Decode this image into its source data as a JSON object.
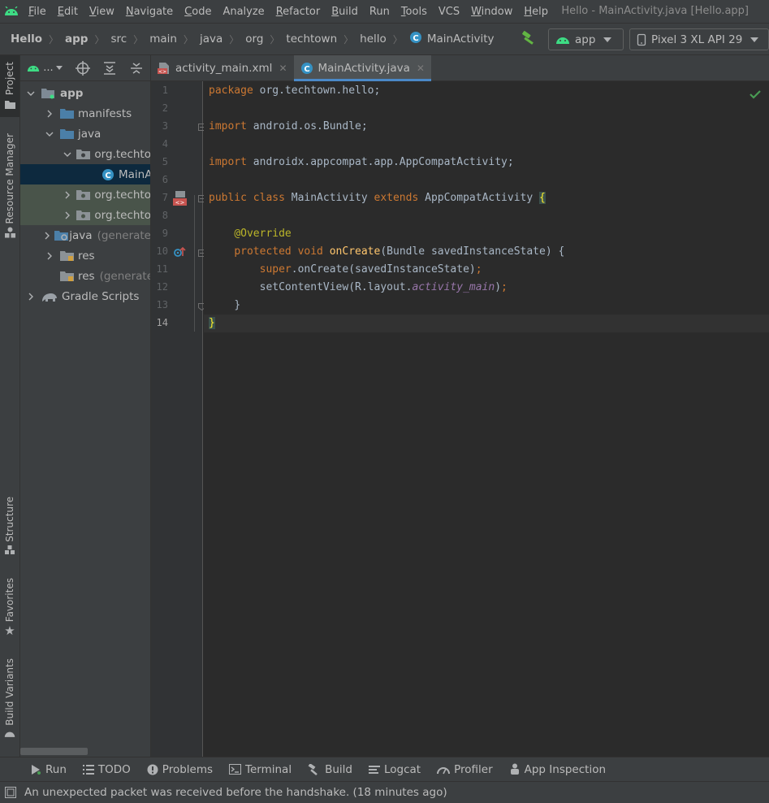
{
  "window": {
    "title": "Hello - MainActivity.java [Hello.app]"
  },
  "colors": {
    "accent": "#4a88c7",
    "android_green": "#3ddc84",
    "keyword": "#cc7832",
    "annotation": "#bbb529",
    "method": "#ffc66d",
    "field": "#9876aa",
    "text": "#a9b7c6"
  },
  "menu": [
    {
      "mnemonic": "F",
      "rest": "ile"
    },
    {
      "mnemonic": "E",
      "rest": "dit"
    },
    {
      "mnemonic": "V",
      "rest": "iew"
    },
    {
      "mnemonic": "N",
      "rest": "avigate"
    },
    {
      "mnemonic": "C",
      "rest": "ode"
    },
    {
      "mnemonic": "",
      "rest": "Analyze"
    },
    {
      "mnemonic": "R",
      "rest": "efactor"
    },
    {
      "mnemonic": "B",
      "rest": "uild"
    },
    {
      "mnemonic": "",
      "rest": "Run"
    },
    {
      "mnemonic": "T",
      "rest": "ools"
    },
    {
      "mnemonic": "",
      "rest": "VCS"
    },
    {
      "mnemonic": "W",
      "rest": "indow"
    },
    {
      "mnemonic": "H",
      "rest": "elp"
    }
  ],
  "breadcrumb": [
    "Hello",
    "app",
    "src",
    "main",
    "java",
    "org",
    "techtown",
    "hello",
    "MainActivity"
  ],
  "run_config": {
    "label": "app"
  },
  "device": {
    "label": "Pixel 3 XL API 29"
  },
  "left_stripe": {
    "project": "Project",
    "resource_manager": "Resource Manager",
    "structure": "Structure",
    "favorites": "Favorites",
    "build_variants": "Build Variants"
  },
  "project_panel": {
    "view_label": "...",
    "tree": [
      {
        "label": "app",
        "extra": ""
      },
      {
        "label": "manifests",
        "extra": ""
      },
      {
        "label": "java",
        "extra": ""
      },
      {
        "label": "org.techto",
        "extra": ""
      },
      {
        "label": "MainA",
        "extra": ""
      },
      {
        "label": "org.techto",
        "extra": ""
      },
      {
        "label": "org.techto",
        "extra": ""
      },
      {
        "label": "java",
        "extra": "(generate"
      },
      {
        "label": "res",
        "extra": ""
      },
      {
        "label": "res",
        "extra": "(generate"
      },
      {
        "label": "Gradle Scripts",
        "extra": ""
      }
    ]
  },
  "editor_tabs": [
    {
      "label": "activity_main.xml",
      "icon": "xml-file-icon",
      "active": false
    },
    {
      "label": "MainActivity.java",
      "icon": "java-class-icon",
      "active": true
    }
  ],
  "line_numbers": [
    "1",
    "2",
    "3",
    "4",
    "5",
    "6",
    "7",
    "8",
    "9",
    "10",
    "11",
    "12",
    "13",
    "14"
  ],
  "code": {
    "l1_kw": "package",
    "l1_rest": " org.techtown.hello;",
    "l3_kw": "import",
    "l3_rest": " android.os.Bundle;",
    "l5_kw": "import",
    "l5_rest": " androidx.appcompat.app.AppCompatActivity;",
    "l7_kw1": "public class",
    "l7_name": " MainActivity ",
    "l7_kw2": "extends",
    "l7_super": " AppCompatActivity ",
    "l7_brace": "{",
    "l9_ann": "@Override",
    "l10_kw": "protected void",
    "l10_fn": "onCreate",
    "l10_rest": "(Bundle savedInstanceState) {",
    "l11_kw": "super",
    "l11_rest": ".onCreate(savedInstanceState)",
    "l12_pre": "setContentView(R.layout.",
    "l12_fld": "activity_main",
    "l12_post": ")",
    "semicolon": ";",
    "l13": "}",
    "l14": "}"
  },
  "tool_windows": [
    {
      "label": "Run",
      "icon": "run-icon"
    },
    {
      "label": "TODO",
      "icon": "todo-icon"
    },
    {
      "label": "Problems",
      "icon": "problems-icon"
    },
    {
      "label": "Terminal",
      "icon": "terminal-icon"
    },
    {
      "label": "Build",
      "icon": "build-icon"
    },
    {
      "label": "Logcat",
      "icon": "logcat-icon"
    },
    {
      "label": "Profiler",
      "icon": "profiler-icon"
    },
    {
      "label": "App Inspection",
      "icon": "app-inspection-icon"
    }
  ],
  "status": {
    "message": "An unexpected packet was received before the handshake. (18 minutes ago)"
  }
}
